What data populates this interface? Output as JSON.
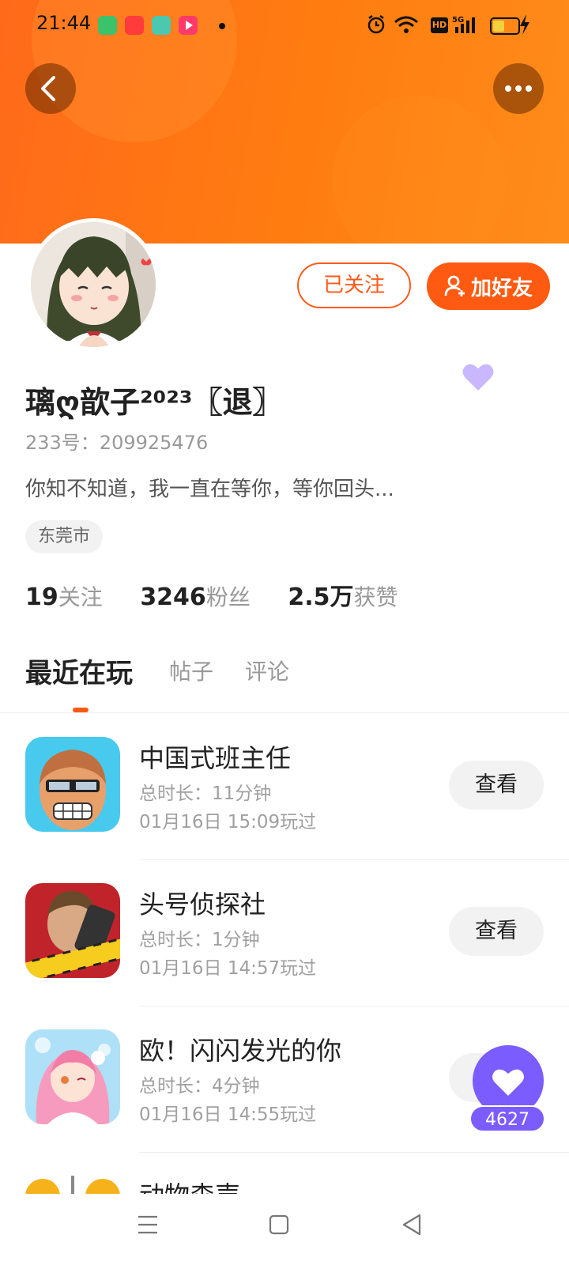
{
  "status_bar": {
    "time": "21:44",
    "hd_label": "HD",
    "network_label": "5G"
  },
  "header": {
    "back_icon": "chevron-left-icon",
    "more_icon": "more-dots-icon",
    "accent_color": "#ff6a1a"
  },
  "profile": {
    "username": "璃ღ歆子²⁰²³〖退〗",
    "uid": "233号：209925476",
    "bio": "你知不知道，我一直在等你，等你回头...",
    "location": "东莞市",
    "followed_label": "已关注",
    "add_friend_label": "加好友"
  },
  "stats": [
    {
      "value": "19",
      "label": "关注"
    },
    {
      "value": "3246",
      "label": "粉丝"
    },
    {
      "value": "2.5万",
      "label": "获赞"
    }
  ],
  "tabs": [
    {
      "label": "最近在玩",
      "active": true
    },
    {
      "label": "帖子",
      "active": false
    },
    {
      "label": "评论",
      "active": false
    }
  ],
  "games": [
    {
      "name": "中国式班主任",
      "duration": "总时长：11分钟",
      "played": "01月16日 15:09玩过",
      "button": "查看"
    },
    {
      "name": "头号侦探社",
      "duration": "总时长：1分钟",
      "played": "01月16日 14:57玩过",
      "button": "查看"
    },
    {
      "name": "欧！闪闪发光的你",
      "duration": "总时长：4分钟",
      "played": "01月16日 14:55玩过",
      "button": "查看"
    },
    {
      "name": "动物森声",
      "duration": "",
      "played": "",
      "button": ""
    }
  ],
  "like_fab": {
    "count": "4627",
    "color": "#7b5cff"
  }
}
